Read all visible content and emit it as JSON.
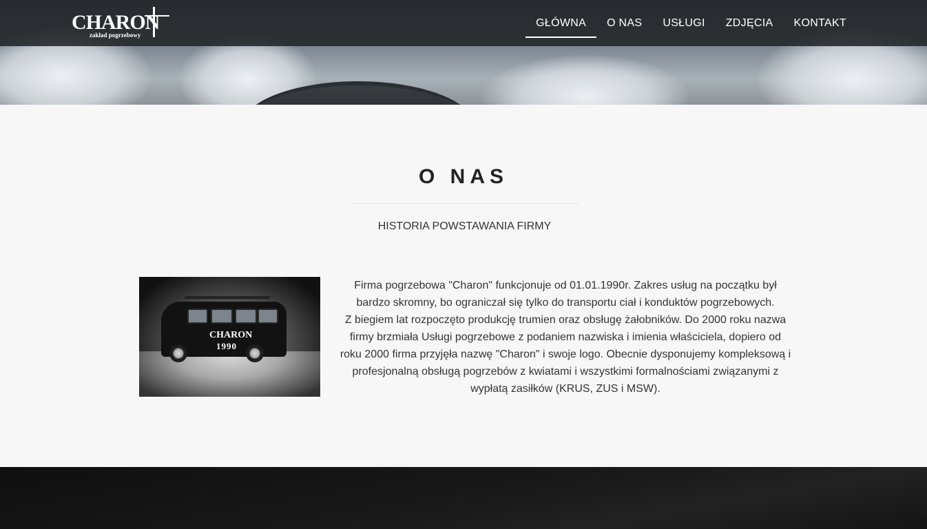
{
  "brand": {
    "name": "CHARON",
    "tagline": "zakład pogrzebowy"
  },
  "nav": {
    "items": [
      {
        "label": "GŁÓWNA",
        "active": true
      },
      {
        "label": "O NAS",
        "active": false
      },
      {
        "label": "USŁUGI",
        "active": false
      },
      {
        "label": "ZDJĘCIA",
        "active": false
      },
      {
        "label": "KONTAKT",
        "active": false
      }
    ]
  },
  "about": {
    "title": "O NAS",
    "subtitle": "HISTORIA POWSTAWANIA FIRMY",
    "photo": {
      "brand_text": "CHARON",
      "year_text": "1990"
    },
    "paragraphs": [
      "Firma pogrzebowa \"Charon\" funkcjonuje od 01.01.1990r. Zakres usług na początku był bardzo skromny, bo ograniczał się tylko do transportu ciał i konduktów pogrzebowych.",
      "Z biegiem lat rozpoczęto produkcję trumien oraz obsługę żałobników. Do 2000 roku nazwa firmy brzmiała Usługi pogrzebowe z podaniem nazwiska i imienia właściciela, dopiero od roku 2000 firma przyjęła nazwę \"Charon\" i swoje logo. Obecnie dysponujemy kompleksową i profesjonalną obsługą pogrzebów z kwiatami i wszystkimi formalnościami związanymi z wypłatą zasiłków (KRUS, ZUS i MSW)."
    ]
  },
  "colors": {
    "navbar": "#222427",
    "page_bg": "#f7f7f7",
    "text": "#333333",
    "title": "#222222"
  }
}
